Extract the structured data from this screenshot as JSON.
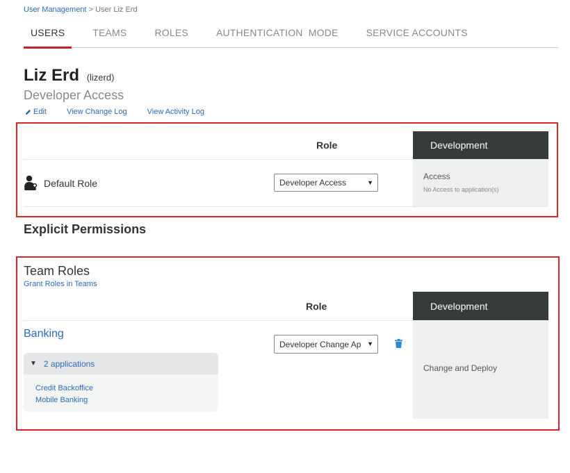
{
  "breadcrumb": {
    "parent": "User Management",
    "separator": ">",
    "current": "User Liz Erd"
  },
  "tabs": [
    {
      "label": "USERS",
      "active": true
    },
    {
      "label": "TEAMS",
      "active": false
    },
    {
      "label": "ROLES",
      "active": false
    },
    {
      "label": "AUTHENTICATION  MODE",
      "active": false
    },
    {
      "label": "SERVICE ACCOUNTS",
      "active": false
    }
  ],
  "user": {
    "name": "Liz Erd",
    "login": "(lizerd)",
    "role": "Developer Access"
  },
  "actions": {
    "edit": "Edit",
    "change_log": "View Change Log",
    "activity_log": "View Activity Log"
  },
  "default_role_section": {
    "role_header": "Role",
    "env_header": "Development",
    "label": "Default Role",
    "selected_role": "Developer Access",
    "access_title": "Access",
    "access_detail": "No Access to application(s)"
  },
  "explicit_title": "Explicit Permissions",
  "team_roles": {
    "title": "Team Roles",
    "grant_link": "Grant Roles in Teams",
    "role_header": "Role",
    "env_header": "Development",
    "team": {
      "name": "Banking",
      "selected_role": "Developer Change Ap",
      "apps_toggle": "2 applications",
      "apps": [
        "Credit Backoffice",
        "Mobile Banking"
      ],
      "env_value": "Change and Deploy"
    }
  },
  "colors": {
    "accent_red": "#d9262c",
    "link_blue": "#2a6ab8",
    "env_header_bg": "#363c3c",
    "trash_blue": "#2e8bd0"
  }
}
